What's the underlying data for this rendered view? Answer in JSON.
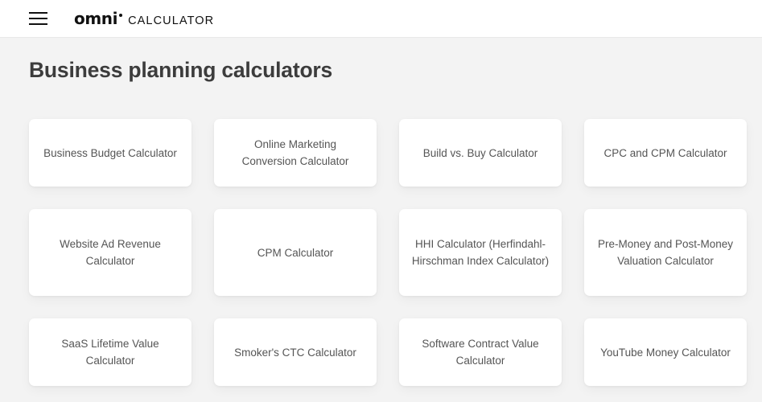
{
  "header": {
    "menu_icon": "hamburger-menu-icon",
    "brand_name": "omni",
    "brand_dot": "",
    "brand_suffix": "CALCULATOR"
  },
  "main": {
    "page_title": "Business planning calculators"
  },
  "colors": {
    "page_background": "#f3f3f3",
    "header_background": "#ffffff",
    "card_background": "#ffffff",
    "title_text": "#3c3c3c",
    "card_text": "#555555",
    "logo_text": "#111111",
    "header_border": "#e8e8e8"
  },
  "cards": {
    "rows": [
      {
        "height": "short",
        "items": [
          {
            "label": "Business Budget Calculator"
          },
          {
            "label": "Online Marketing Conversion Calculator"
          },
          {
            "label": "Build vs. Buy Calculator"
          },
          {
            "label": "CPC and CPM Calculator"
          }
        ]
      },
      {
        "height": "tall",
        "items": [
          {
            "label": "Website Ad Revenue Calculator"
          },
          {
            "label": "CPM Calculator"
          },
          {
            "label": "HHI Calculator (Herfindahl-Hirschman Index Calculator)"
          },
          {
            "label": "Pre-Money and Post-Money Valuation Calculator"
          }
        ]
      },
      {
        "height": "short",
        "items": [
          {
            "label": "SaaS Lifetime Value Calculator"
          },
          {
            "label": "Smoker's CTC Calculator"
          },
          {
            "label": "Software Contract Value Calculator"
          },
          {
            "label": "YouTube Money Calculator"
          }
        ]
      }
    ]
  }
}
